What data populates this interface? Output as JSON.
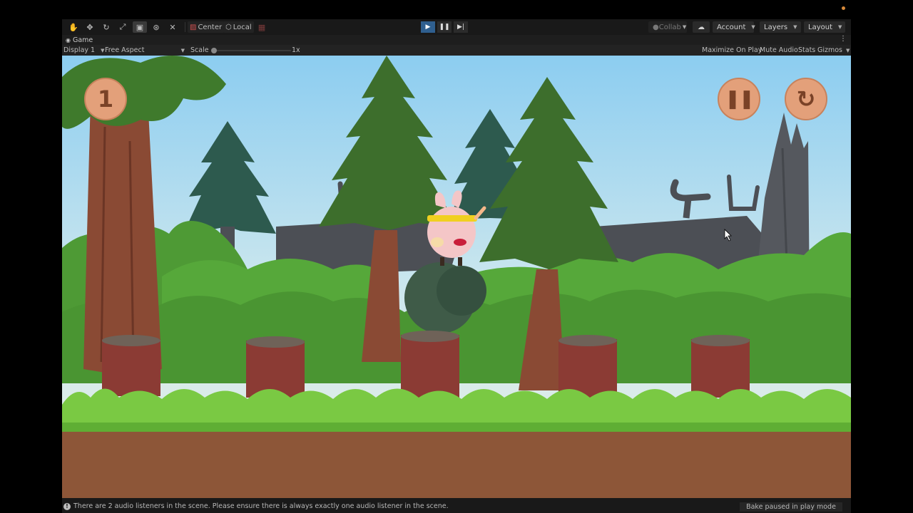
{
  "toolbar": {
    "tools": [
      "hand-tool",
      "move-tool",
      "rotate-tool",
      "scale-tool",
      "rect-tool",
      "transform-tool",
      "custom-tool"
    ],
    "pivot_label": "Center",
    "space_label": "Local",
    "collab_label": "Collab",
    "account_label": "Account",
    "layers_label": "Layers",
    "layout_label": "Layout"
  },
  "tab": {
    "title": "Game"
  },
  "gamebar": {
    "display": "Display 1",
    "aspect": "Free Aspect",
    "scale_label": "Scale",
    "scale_value": "1x",
    "maximize": "Maximize On Play",
    "mute": "Mute Audio",
    "stats": "Stats",
    "gizmos": "Gizmos"
  },
  "game": {
    "score": "1",
    "pause_icon": "pause-icon",
    "restart_icon": "restart-icon"
  },
  "status": {
    "message": "There are 2 audio listeners in the scene. Please ensure there is always exactly one audio listener in the scene.",
    "bake": "Bake paused in play mode"
  },
  "colors": {
    "sky_top": "#8ccdf0",
    "sky_bottom": "#dcebe7",
    "grass": "#7ac943",
    "dirt": "#8d5638",
    "hud_button": "#e3a07a"
  }
}
